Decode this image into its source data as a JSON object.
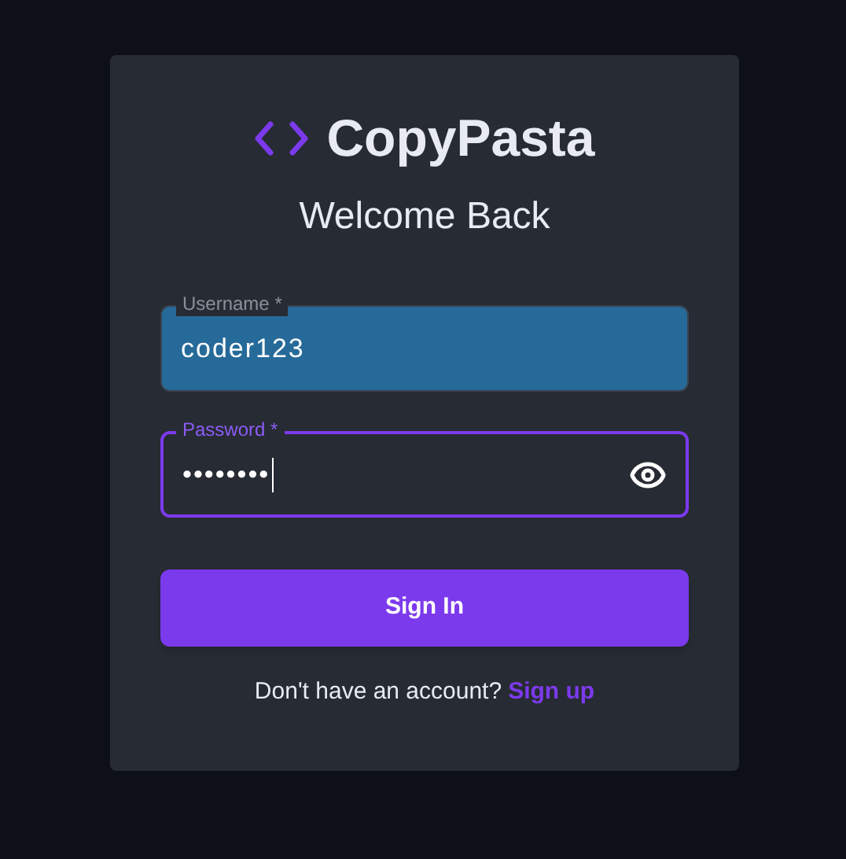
{
  "logo": {
    "text": "CopyPasta"
  },
  "heading": "Welcome Back",
  "fields": [
    {
      "label": "Username *",
      "value": "coder123",
      "kind": "text",
      "focused": false,
      "autofilled": true
    },
    {
      "label": "Password *",
      "value": "••••••••",
      "kind": "password",
      "focused": true,
      "autofilled": false
    }
  ],
  "submit": "Sign In",
  "footer": {
    "text": "Don't have an account?",
    "link": "Sign up"
  }
}
